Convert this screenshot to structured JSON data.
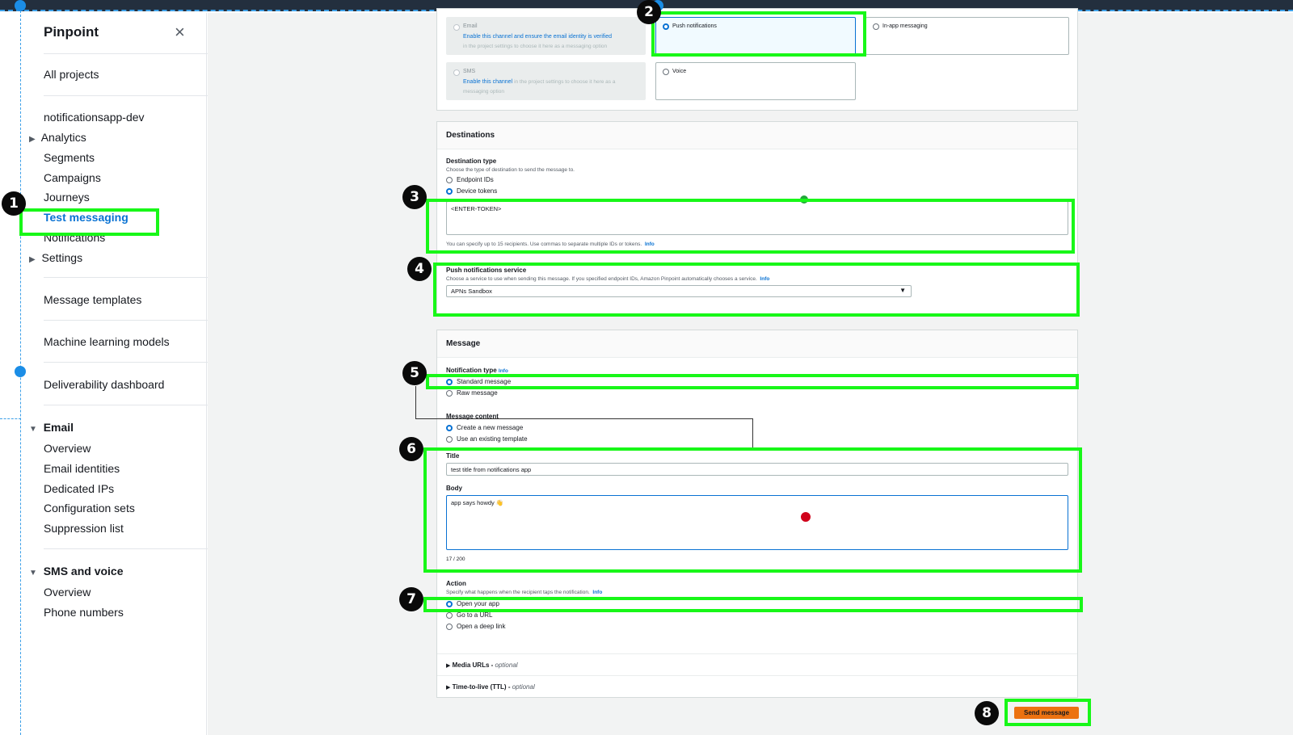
{
  "sidebar": {
    "title": "Pinpoint",
    "close_glyph": "×",
    "all_projects": "All projects",
    "project_name": "notificationsapp-dev",
    "items": [
      {
        "label": "Analytics",
        "expandable": true
      },
      {
        "label": "Segments"
      },
      {
        "label": "Campaigns"
      },
      {
        "label": "Journeys"
      },
      {
        "label": "Test messaging",
        "active": true
      },
      {
        "label": "Notifications"
      },
      {
        "label": "Settings",
        "expandable": true
      }
    ],
    "message_templates": "Message templates",
    "ml_models": "Machine learning models",
    "deliverability": "Deliverability dashboard",
    "email_section": {
      "title": "Email",
      "items": [
        "Overview",
        "Email identities",
        "Dedicated IPs",
        "Configuration sets",
        "Suppression list"
      ]
    },
    "sms_section": {
      "title": "SMS and voice",
      "items": [
        "Overview",
        "Phone numbers"
      ]
    }
  },
  "channels": {
    "email": {
      "label": "Email",
      "desc_link": "Enable this channel and ensure the email identity is verified",
      "desc_rest": "in the project settings to choose it here as a messaging option"
    },
    "push": {
      "label": "Push notifications"
    },
    "inapp": {
      "label": "In-app messaging"
    },
    "sms": {
      "label": "SMS",
      "desc_link": "Enable this channel",
      "desc_rest1": "in the project settings to choose it here as a",
      "desc_rest2": "messaging option"
    },
    "voice": {
      "label": "Voice"
    }
  },
  "destinations": {
    "heading": "Destinations",
    "type_label": "Destination type",
    "type_desc": "Choose the type of destination to send the message to.",
    "opt_endpoint": "Endpoint IDs",
    "opt_device": "Device tokens",
    "token_value": "<ENTER-TOKEN>",
    "hint": "You can specify up to 15 recipients. Use commas to separate multiple IDs or tokens.",
    "info": "Info",
    "service_label": "Push notifications service",
    "service_desc": "Choose a service to use when sending this message. If you specified endpoint IDs, Amazon Pinpoint automatically chooses a service.",
    "service_value": "APNs Sandbox"
  },
  "message": {
    "heading": "Message",
    "notif_type_label": "Notification type",
    "info": "Info",
    "opt_standard": "Standard message",
    "opt_raw": "Raw message",
    "content_label": "Message content",
    "opt_create": "Create a new message",
    "opt_template": "Use an existing template",
    "title_label": "Title",
    "title_value": "test title from notifications app",
    "body_label": "Body",
    "body_value": "app says howdy 👋",
    "counter": "17 / 200",
    "action_label": "Action",
    "action_desc": "Specify what happens when the recipient taps the notification.",
    "opt_open": "Open your app",
    "opt_url": "Go to a URL",
    "opt_deeplink": "Open a deep link",
    "media_urls": "Media URLs",
    "ttl": "Time-to-live (TTL)",
    "optional": "optional",
    "send": "Send message"
  },
  "annotations": [
    "1",
    "2",
    "3",
    "4",
    "5",
    "6",
    "7",
    "8"
  ],
  "colors": {
    "highlight": "#18f718",
    "accent": "#0972d3",
    "send": "#ec7211",
    "topbar": "#232f3e"
  }
}
